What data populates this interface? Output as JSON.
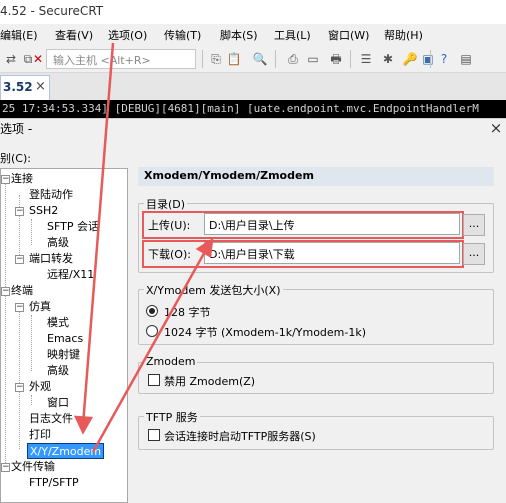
{
  "window": {
    "title": "4.52 - SecureCRT"
  },
  "menu": [
    "编辑(E)",
    "查看(V)",
    "选项(O)",
    "传输(T)",
    "脚本(S)",
    "工具(L)",
    "窗口(W)",
    "帮助(H)"
  ],
  "toolbar": {
    "quick_connect_placeholder": "输入主机 <Alt+R>"
  },
  "tab": {
    "label": "3.52",
    "close": "×"
  },
  "terminal": {
    "line": "25 17:34:53.334] [DEBUG][4681][main] [uate.endpoint.mvc.EndpointHandlerM"
  },
  "dialog": {
    "title": "选项 -",
    "close": "×",
    "category_label": "别(C):",
    "tree": {
      "connect": "连接",
      "login_actions": "登陆动作",
      "ssh2": "SSH2",
      "sftp_session": "SFTP 会话",
      "advanced_ssh2": "高级",
      "port_forward": "端口转发",
      "remote_x11": "远程/X11",
      "terminal": "终端",
      "emulation": "仿真",
      "modes": "模式",
      "emacs": "Emacs",
      "mapped_keys": "映射键",
      "advanced_emu": "高级",
      "appearance": "外观",
      "window": "窗口",
      "log_file": "日志文件",
      "print": "打印",
      "xyzmodem": "X/Y/Zmodem",
      "file_transfer": "文件传输",
      "ftp_sftp": "FTP/SFTP"
    },
    "panel": {
      "header": "Xmodem/Ymodem/Zmodem",
      "directories": {
        "legend": "目录(D)",
        "upload_label": "上传(U):",
        "upload_value": "D:\\用户目录\\上传",
        "download_label": "下载(O):",
        "download_value": "D:\\用户目录\\下载",
        "browse": "..."
      },
      "packet_size": {
        "legend": "X/Ymodem 发送包大小(X)",
        "opt_128": "128 字节",
        "opt_1024": "1024 字节  (Xmodem-1k/Ymodem-1k)",
        "selected": "128 字节"
      },
      "zmodem": {
        "legend": "Zmodem",
        "disable_label": "禁用 Zmodem(Z)",
        "disable_checked": false
      },
      "tftp": {
        "legend": "TFTP 服务",
        "start_label": "会话连接时启动TFTP服务器(S)",
        "start_checked": false
      }
    }
  },
  "colors": {
    "annotation": "#e85a5a",
    "selection": "#3399ff",
    "header_bg": "#dfe6ee"
  }
}
